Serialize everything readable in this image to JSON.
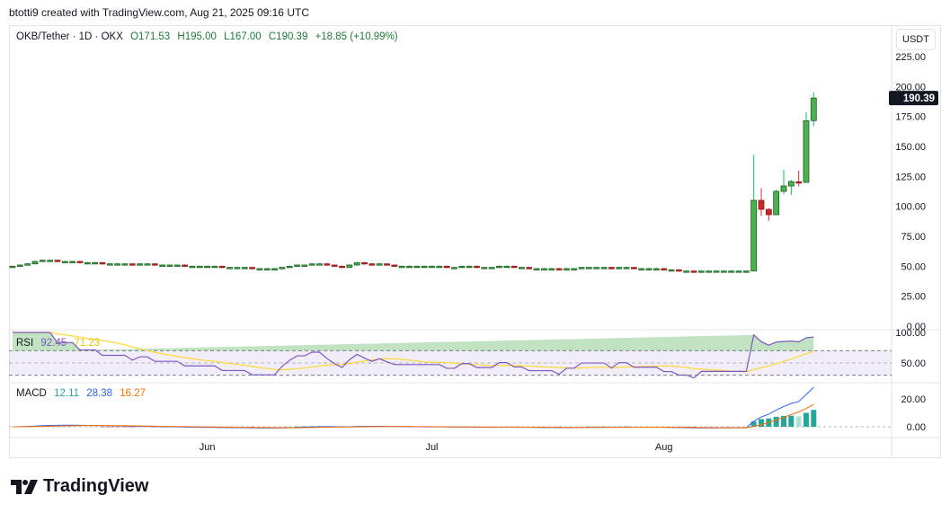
{
  "header": {
    "attribution": "btotti9 created with TradingView.com, Aug 21, 2025 09:16 UTC"
  },
  "legend": {
    "symbol": "OKB/Tether · 1D · OKX",
    "open": "O171.53",
    "high": "H195.00",
    "low": "L167.00",
    "close": "C190.39",
    "change": "+18.85 (+10.99%)"
  },
  "currency_button": "USDT",
  "last_price_label": "190.39",
  "rsi_legend": {
    "name": "RSI",
    "value": "92.45",
    "ma": "71.23"
  },
  "macd_legend": {
    "name": "MACD",
    "hist": "12.11",
    "macd": "28.38",
    "signal": "16.27"
  },
  "logo_text": "TradingView",
  "colors": {
    "up": "#4caf50",
    "up_border": "#1b5e20",
    "down": "#c62828",
    "rsi": "#7e57c2",
    "rsi_ma": "#fdd835",
    "macd": "#2962ff",
    "signal": "#ff6d00",
    "hist": "#26a69a",
    "hist_light": "#b2dfdb"
  },
  "chart_data": {
    "type": "candlestick",
    "title": "OKB/Tether · 1D · OKX",
    "start_date": "2025-05-06",
    "price_axis": {
      "ticks": [
        "225.00",
        "200.00",
        "175.00",
        "150.00",
        "125.00",
        "100.00",
        "75.00",
        "50.00",
        "25.00",
        "0.00"
      ],
      "ylim": [
        0,
        225
      ]
    },
    "rsi_axis": {
      "ticks": [
        "100.00",
        "50.00"
      ],
      "ylim": [
        0,
        100
      ],
      "bands": [
        30,
        50,
        70
      ]
    },
    "macd_axis": {
      "ticks": [
        "20.00",
        "0.00"
      ]
    },
    "time_axis": [
      {
        "label": "Jun",
        "index": 26
      },
      {
        "label": "Jul",
        "index": 56
      },
      {
        "label": "Aug",
        "index": 87
      }
    ],
    "flat_closes": [
      50,
      51,
      52,
      54,
      55,
      55,
      54,
      54,
      54,
      53,
      53,
      53,
      52,
      52,
      52,
      52,
      51,
      52,
      52,
      51,
      51,
      51,
      51,
      50,
      50,
      50,
      50,
      50,
      49,
      49,
      49,
      49,
      48,
      48,
      48,
      48,
      49,
      50,
      51,
      51,
      52,
      52,
      51,
      50,
      49,
      51,
      53,
      52,
      51,
      52,
      51,
      50,
      50,
      50,
      50,
      50,
      50,
      50,
      49,
      49,
      50,
      50,
      49,
      49,
      49,
      50,
      50,
      49,
      49,
      48,
      48,
      48,
      48,
      47,
      48,
      48,
      49,
      49,
      49,
      49,
      48,
      49,
      49,
      48,
      48,
      48,
      48,
      47,
      47,
      46,
      46,
      45,
      46,
      46,
      46,
      46,
      46,
      46,
      46
    ],
    "recent_ohlc": [
      [
        46,
        143,
        46,
        105
      ],
      [
        105,
        115,
        92,
        97.5
      ],
      [
        97.5,
        98.5,
        88,
        93
      ],
      [
        93,
        114,
        93,
        112.5
      ],
      [
        112.5,
        130.5,
        110,
        117
      ],
      [
        117,
        122,
        109.5,
        120.7
      ],
      [
        120.5,
        130,
        116.7,
        119.5
      ],
      [
        120,
        178.5,
        120,
        171.5
      ],
      [
        171.53,
        195,
        167,
        190.39
      ]
    ]
  }
}
